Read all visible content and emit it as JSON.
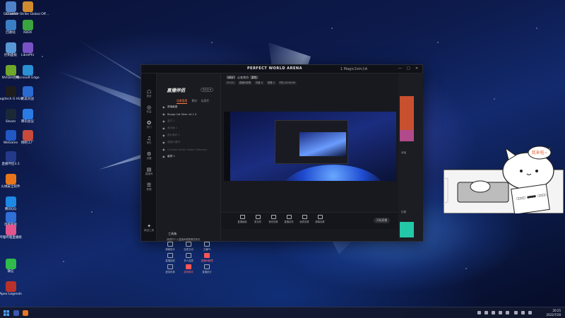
{
  "desktop": {
    "icons": [
      {
        "label": "GEF0050",
        "color": "#4f82c9"
      },
      {
        "label": "Counter-Strike Global Off...",
        "color": "#d18a2e"
      },
      {
        "label": "回收站",
        "color": "#3c7ec3"
      },
      {
        "label": "XBOX",
        "color": "#3aa43e"
      },
      {
        "label": "控制面板",
        "color": "#5797d6"
      },
      {
        "label": "LibrePhi",
        "color": "#7a52c7"
      },
      {
        "label": "NVIDIA控制",
        "color": "#6fa829"
      },
      {
        "label": "Microsoft Edge",
        "color": "#2a8fd3"
      },
      {
        "label": "Logitech G HUB",
        "color": "#1d1d1d"
      },
      {
        "label": "完美对战",
        "color": "#2b6bd1"
      },
      {
        "label": "Steam",
        "color": "#1b2838"
      },
      {
        "label": "腾讯会议",
        "color": "#2a7be4"
      },
      {
        "label": "WeGame",
        "color": "#2257c4"
      },
      {
        "label": "网吧工厂",
        "color": "#c64b3c"
      },
      {
        "label": "直播伴侣3.3",
        "color": "#233a8a"
      },
      {
        "label": "火绒安全软件",
        "color": "#e8751a"
      },
      {
        "label": "腾讯QQ",
        "color": "#1e88e5"
      },
      {
        "label": "电脑管家",
        "color": "#2f6fd6"
      },
      {
        "label": "哔哩哔哩直播姬",
        "color": "#e1558c"
      },
      {
        "label": "微信",
        "color": "#2ebd4a"
      },
      {
        "label": "Apex Legends",
        "color": "#b8322b"
      }
    ]
  },
  "app": {
    "brand": "PERFECT WORLD ARENA",
    "user": "1 Magic1ish小A",
    "logo": "直播伴侣",
    "logo_badge": "3.0.1 ▾",
    "rail": [
      {
        "glyph": "☖",
        "label": "首页"
      },
      {
        "glyph": "◎",
        "label": "收益"
      },
      {
        "glyph": "✪",
        "label": "热门"
      },
      {
        "glyph": "♫",
        "label": "音乐"
      },
      {
        "glyph": "⚙",
        "label": "设置"
      },
      {
        "glyph": "▤",
        "label": "直播间"
      },
      {
        "glyph": "☰",
        "label": "数据"
      },
      {
        "glyph": "✦",
        "label": "精选工具"
      }
    ],
    "tabs": [
      "场景管理",
      "素材",
      "玩家栏"
    ],
    "scenes": [
      {
        "label": "屏幕截图",
        "dim": false
      },
      {
        "label": "Bongo Cat Mver v0.1.3",
        "dim": false
      },
      {
        "label": "窗口 1",
        "dim": true
      },
      {
        "label": "画中画 1",
        "dim": true
      },
      {
        "label": "图片素材 1",
        "dim": true
      },
      {
        "label": "摄像头素材",
        "dim": true
      },
      {
        "label": "Counter-Strike Global Offensive",
        "dim": true
      },
      {
        "label": "截屏 1",
        "dim": false
      }
    ],
    "tools_header": "工具箱",
    "tools": [
      {
        "label": "弹幕助手",
        "hl": false
      },
      {
        "label": "连麦互动",
        "hl": false
      },
      {
        "label": "主播PK",
        "hl": false
      },
      {
        "label": "直播抽奖",
        "hl": false
      },
      {
        "label": "多人连麦",
        "hl": false
      },
      {
        "label": "直播间管理",
        "hl": true
      },
      {
        "label": "虚拟形象",
        "hl": false
      },
      {
        "label": "游戏助手",
        "hl": true
      },
      {
        "label": "直播统计",
        "hl": false
      }
    ],
    "notice": "我想开个人直播间需要哪些条件",
    "stream_title": "【横屏】 心在何方",
    "stream_tag": "游戏",
    "sub_chips": [
      "CS:GO",
      "直播间设置",
      "热度 0",
      "观看 0",
      "时长 00:00:00"
    ],
    "bottom": [
      {
        "label": "直播画面"
      },
      {
        "label": "麦克风"
      },
      {
        "label": "音效设置"
      },
      {
        "label": "直播反馈"
      },
      {
        "label": "画质设置"
      },
      {
        "label": "弹幕设置"
      }
    ],
    "golive": "开始直播",
    "chat_labels": [
      "对话",
      "礼物"
    ]
  },
  "cat_overlay": {
    "bubble_text": "我来啦~",
    "keys_text": "□□□□ ■■■■ □□□□"
  },
  "taskbar": {
    "time": "20:25",
    "date": "2022/7/28"
  }
}
